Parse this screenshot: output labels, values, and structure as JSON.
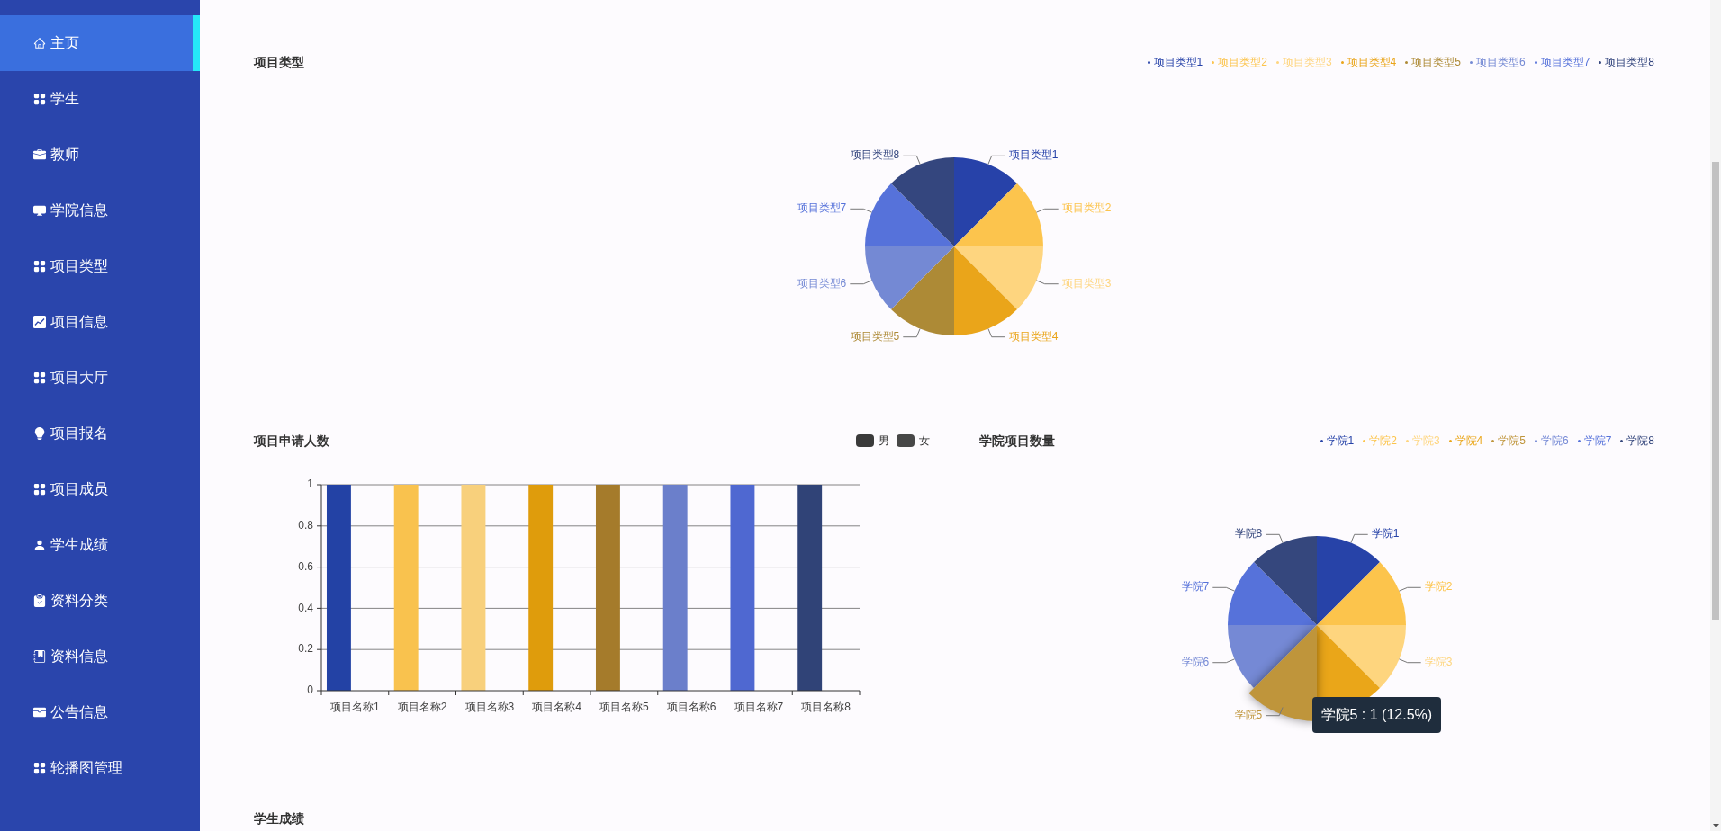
{
  "sidebar": {
    "items": [
      {
        "label": "主页",
        "selected": true
      },
      {
        "label": "学生",
        "selected": false
      },
      {
        "label": "教师",
        "selected": false
      },
      {
        "label": "学院信息",
        "selected": false
      },
      {
        "label": "项目类型",
        "selected": false
      },
      {
        "label": "项目信息",
        "selected": false
      },
      {
        "label": "项目大厅",
        "selected": false
      },
      {
        "label": "项目报名",
        "selected": false
      },
      {
        "label": "项目成员",
        "selected": false
      },
      {
        "label": "学生成绩",
        "selected": false
      },
      {
        "label": "资料分类",
        "selected": false
      },
      {
        "label": "资料信息",
        "selected": false
      },
      {
        "label": "公告信息",
        "selected": false
      },
      {
        "label": "轮播图管理",
        "selected": false
      }
    ]
  },
  "project_types": {
    "title": "项目类型",
    "legend": [
      "项目类型1",
      "项目类型2",
      "项目类型3",
      "项目类型4",
      "项目类型5",
      "项目类型6",
      "项目类型7",
      "项目类型8"
    ],
    "chart_data": {
      "type": "pie",
      "categories": [
        "项目类型1",
        "项目类型2",
        "项目类型3",
        "项目类型4",
        "项目类型5",
        "项目类型6",
        "项目类型7",
        "项目类型8"
      ],
      "values": [
        1,
        1,
        1,
        1,
        1,
        1,
        1,
        1
      ],
      "colors": [
        "#2742a9",
        "#fcc44d",
        "#fed57f",
        "#eaa51a",
        "#ad8a36",
        "#7489d4",
        "#5672da",
        "#34467e"
      ]
    }
  },
  "project_applicants": {
    "title": "项目申请人数",
    "legend_swatches": [
      {
        "color": "#3a3a3a"
      },
      {
        "color": "#474747"
      }
    ],
    "chart_data": {
      "type": "bar",
      "categories": [
        "项目名称1",
        "项目名称2",
        "项目名称3",
        "项目名称4",
        "项目名称5",
        "项目名称6",
        "项目名称7",
        "项目名称8"
      ],
      "series": [
        {
          "name": "男",
          "colors": [
            "#2342a5",
            "#f9c24e",
            "#f8d07c",
            "#df9c0c",
            "#a57b2b",
            "#6b7fcb",
            "#4f68d1",
            "#304377"
          ],
          "values": [
            1,
            1,
            1,
            1,
            1,
            1,
            1,
            1
          ]
        },
        {
          "name": "女",
          "values": [
            0,
            0,
            0,
            0,
            0,
            0,
            0,
            0
          ]
        }
      ],
      "ylim": [
        0,
        1
      ],
      "yticks": [
        0,
        0.2,
        0.4,
        0.6,
        0.8,
        1
      ],
      "grid": true
    }
  },
  "college_projects": {
    "title": "学院项目数量",
    "legend": [
      "学院1",
      "学院2",
      "学院3",
      "学院4",
      "学院5",
      "学院6",
      "学院7",
      "学院8"
    ],
    "chart_data": {
      "type": "pie",
      "categories": [
        "学院1",
        "学院2",
        "学院3",
        null,
        "学院5",
        "学院6",
        "学院7",
        "学院8"
      ],
      "values": [
        1,
        1,
        1,
        1,
        1,
        1,
        1,
        1
      ],
      "colors": [
        "#2743a8",
        "#fcc44c",
        "#fed57e",
        "#eaa619",
        "#bf953b",
        "#7589d5",
        "#5672da",
        "#35477d"
      ]
    },
    "slices": [
      {
        "highlighted": false
      },
      {
        "highlighted": false
      },
      {
        "highlighted": false
      },
      {
        "highlighted": false
      },
      {
        "highlighted": true
      },
      {
        "highlighted": false
      },
      {
        "highlighted": false
      },
      {
        "highlighted": false
      }
    ],
    "tooltip": {
      "text": "学院5 : 1 (12.5%)"
    }
  },
  "student_scores": {
    "title": "学生成绩"
  }
}
